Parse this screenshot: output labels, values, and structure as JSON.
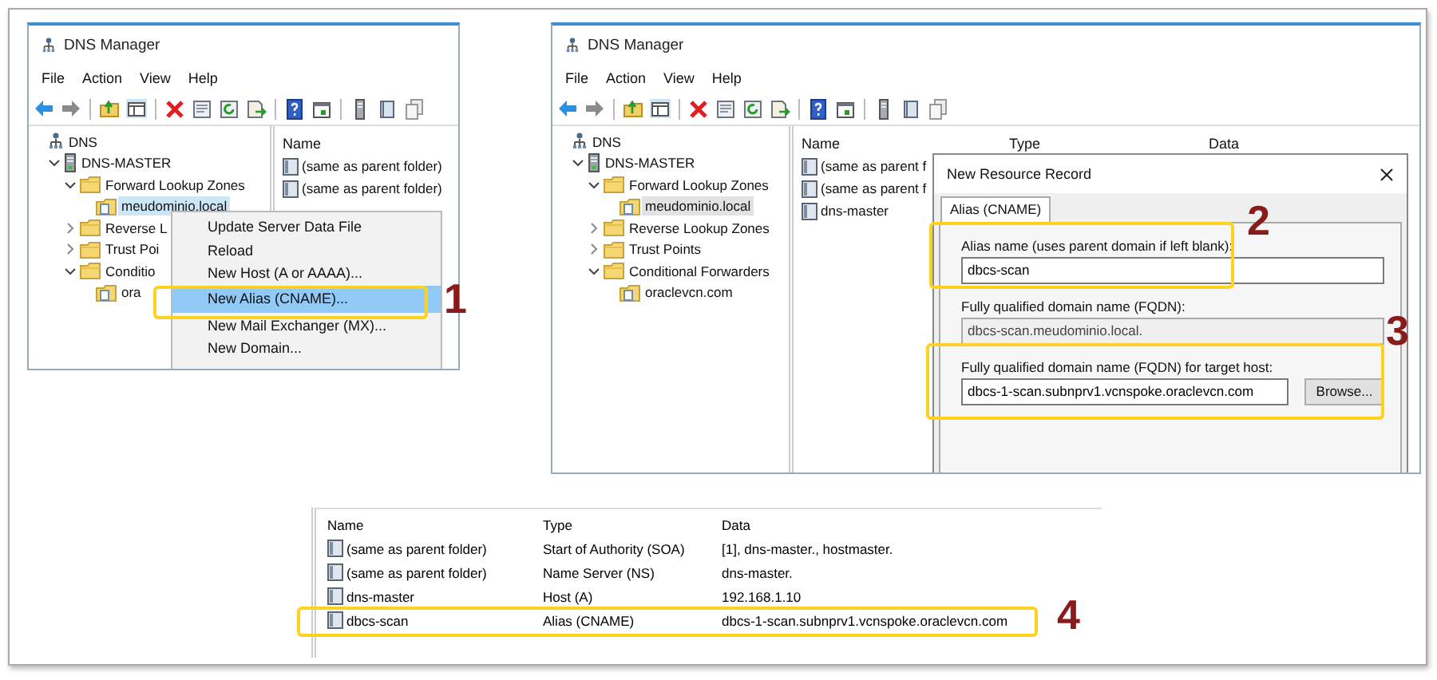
{
  "screens": [
    {
      "kind": "manager",
      "title": "DNS Manager",
      "menu": [
        "File",
        "Action",
        "View",
        "Help"
      ],
      "tree": [
        {
          "label": "DNS",
          "kind": "dns",
          "selected": false,
          "children": [
            {
              "label": "DNS-MASTER",
              "kind": "server",
              "expanded": true,
              "selected": false,
              "children": [
                {
                  "label": "Forward Lookup Zones",
                  "kind": "folder",
                  "expanded": true,
                  "selected": false,
                  "children": [
                    {
                      "label": "meudominio.local",
                      "kind": "zone",
                      "selected": true
                    }
                  ]
                },
                {
                  "label": "Reverse L",
                  "kind": "folder",
                  "expanded": false,
                  "selected": false
                },
                {
                  "label": "Trust Poi",
                  "kind": "folder",
                  "expanded": false,
                  "selected": false
                },
                {
                  "label": "Conditio",
                  "kind": "folder",
                  "expanded": true,
                  "selected": false,
                  "children": [
                    {
                      "label": "ora",
                      "kind": "zone",
                      "selected": false
                    }
                  ]
                }
              ]
            }
          ]
        }
      ],
      "columns": [
        "Name"
      ],
      "rows": [
        {
          "cells": [
            "(same as parent folder)"
          ]
        },
        {
          "cells": [
            "(same as parent folder)"
          ]
        }
      ],
      "context_menu": {
        "items": [
          {
            "label": "Update Server Data File",
            "selected": false
          },
          {
            "label": "Reload",
            "selected": false
          },
          {
            "label": "New Host (A or AAAA)...",
            "selected": false
          },
          {
            "label": "New Alias (CNAME)...",
            "selected": true
          },
          {
            "label": "New Mail Exchanger (MX)...",
            "selected": false
          },
          {
            "label": "New Domain...",
            "selected": false
          }
        ]
      }
    },
    {
      "kind": "manager",
      "title": "DNS Manager",
      "menu": [
        "File",
        "Action",
        "View",
        "Help"
      ],
      "tree": [
        {
          "label": "DNS",
          "kind": "dns",
          "selected": false,
          "children": [
            {
              "label": "DNS-MASTER",
              "kind": "server",
              "expanded": true,
              "selected": false,
              "children": [
                {
                  "label": "Forward Lookup Zones",
                  "kind": "folder",
                  "expanded": true,
                  "selected": false,
                  "children": [
                    {
                      "label": "meudominio.local",
                      "kind": "zone",
                      "selected": true
                    }
                  ]
                },
                {
                  "label": "Reverse Lookup Zones",
                  "kind": "folder",
                  "expanded": false,
                  "selected": false
                },
                {
                  "label": "Trust Points",
                  "kind": "folder",
                  "expanded": false,
                  "selected": false
                },
                {
                  "label": "Conditional Forwarders",
                  "kind": "folder",
                  "expanded": true,
                  "selected": false,
                  "children": [
                    {
                      "label": "oraclevcn.com",
                      "kind": "zone",
                      "selected": false
                    }
                  ]
                }
              ]
            }
          ]
        }
      ],
      "columns": [
        "Name",
        "Type",
        "Data"
      ],
      "rows": [
        {
          "cells": [
            "(same as parent f"
          ]
        },
        {
          "cells": [
            "(same as parent f"
          ]
        },
        {
          "cells": [
            "dns-master"
          ]
        }
      ],
      "dialog": {
        "title": "New Resource Record",
        "tabs": [
          {
            "label": "Alias (CNAME)",
            "selected": true
          }
        ],
        "fields": [
          {
            "label": "Alias name (uses parent domain if left blank):",
            "value": "dbcs-scan",
            "readonly": false
          },
          {
            "label": "Fully qualified domain name (FQDN):",
            "value": "dbcs-scan.meudominio.local.",
            "readonly": true
          },
          {
            "label": "Fully qualified domain name (FQDN) for target host:",
            "value": "dbcs-1-scan.subnprv1.vcnspoke.oraclevcn.com",
            "readonly": false,
            "button": "Browse..."
          }
        ]
      }
    },
    {
      "kind": "records",
      "columns": [
        "Name",
        "Type",
        "Data"
      ],
      "rows": [
        {
          "cells": [
            "(same as parent folder)",
            "Start of Authority (SOA)",
            "[1], dns-master., hostmaster."
          ]
        },
        {
          "cells": [
            "(same as parent folder)",
            "Name Server (NS)",
            "dns-master."
          ]
        },
        {
          "cells": [
            "dns-master",
            "Host (A)",
            "192.168.1.10"
          ]
        },
        {
          "cells": [
            "dbcs-scan",
            "Alias (CNAME)",
            "dbcs-1-scan.subnprv1.vcnspoke.oraclevcn.com"
          ]
        }
      ]
    }
  ],
  "callouts": [
    {
      "number": "1"
    },
    {
      "number": "2"
    },
    {
      "number": "3"
    },
    {
      "number": "4"
    }
  ]
}
